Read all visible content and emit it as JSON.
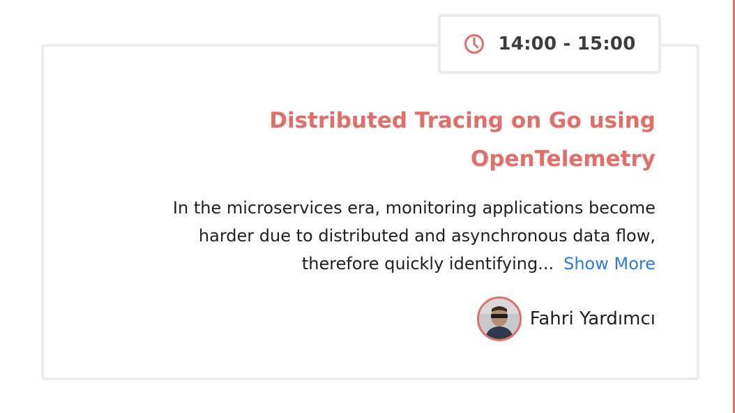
{
  "session": {
    "time": "14:00 - 15:00",
    "title_line1": "Distributed Tracing on Go using",
    "title_line2": "OpenTelemetry",
    "description_line1": "In the microservices era, monitoring applications become",
    "description_line2": "harder due to distributed and asynchronous data flow,",
    "description_line3": "therefore quickly identifying...",
    "show_more_label": "Show More",
    "speaker_name": "Fahri Yardımcı"
  },
  "icons": {
    "time": "clock-icon",
    "speaker": "avatar"
  },
  "colors": {
    "accent": "#e36d67",
    "link": "#2c7be5",
    "text": "#1f1f1f",
    "border": "#ebebeb"
  }
}
